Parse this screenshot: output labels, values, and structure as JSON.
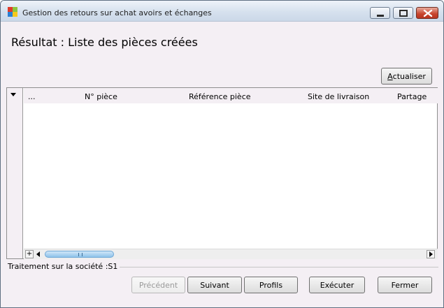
{
  "window": {
    "title": "Gestion des retours sur achat avoirs et échanges",
    "accent_color": "#cbd8e8",
    "close_color": "#c7442d"
  },
  "heading": "Résultat : Liste des pièces créées",
  "toolbar": {
    "refresh_label_accel": "A",
    "refresh_label_rest": "ctualiser"
  },
  "grid": {
    "columns": [
      "...",
      "N° pièce",
      "Référence pièce",
      "Site de livraison",
      "Partage"
    ],
    "rows": [],
    "add_symbol": "+"
  },
  "footer": {
    "status": "Traitement sur la société :S1",
    "buttons": {
      "previous": "Précédent",
      "next": "Suivant",
      "profiles": "Profils",
      "execute": "Exécuter",
      "close": "Fermer"
    }
  }
}
